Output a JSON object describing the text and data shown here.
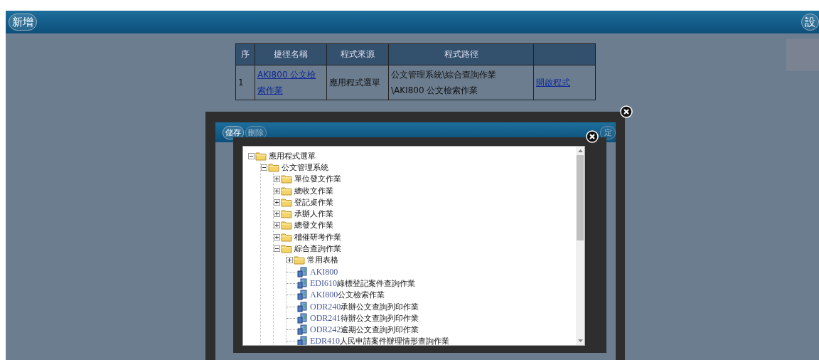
{
  "toolbar": {
    "buttons": [
      {
        "label": "新增"
      },
      {
        "label": "設"
      }
    ]
  },
  "table": {
    "columns": [
      "序",
      "捷徑名稱",
      "程式來源",
      "程式路徑",
      ""
    ],
    "rows": [
      {
        "index": "1",
        "name": "AKI800 公文檢索作業",
        "source": "應用程式選單",
        "path_lines": [
          "公文管理系統\\綜合查詢作業",
          "\\AKI800 公文檢索作業"
        ],
        "action": "開啟程式"
      }
    ]
  },
  "dialog": {
    "buttons": [
      {
        "label": "儲存",
        "disabled": false
      },
      {
        "label": "刪除",
        "disabled": true
      }
    ],
    "right_button": {
      "label": "定",
      "disabled": true
    }
  },
  "tree_dialog": {
    "tree": [
      {
        "kind": "folder",
        "label": "應用程式選單",
        "expanded": true,
        "children": [
          {
            "kind": "folder",
            "label": "公文管理系統",
            "expanded": true,
            "children": [
              {
                "kind": "folder",
                "label": "單位發文作業",
                "expanded": false
              },
              {
                "kind": "folder",
                "label": "總收文作業",
                "expanded": false
              },
              {
                "kind": "folder",
                "label": "登記桌作業",
                "expanded": false
              },
              {
                "kind": "folder",
                "label": "承辦人作業",
                "expanded": false
              },
              {
                "kind": "folder",
                "label": "總發文作業",
                "expanded": false
              },
              {
                "kind": "folder",
                "label": "稽催研考作業",
                "expanded": false
              },
              {
                "kind": "folder",
                "label": "綜合查詢作業",
                "expanded": true,
                "children": [
                  {
                    "kind": "folder",
                    "label": "常用表格",
                    "expanded": false
                  },
                  {
                    "kind": "program",
                    "code": "AKI800"
                  },
                  {
                    "kind": "program",
                    "code": "EDI610",
                    "label": "綠標登記案件查詢作業"
                  },
                  {
                    "kind": "program",
                    "code": "AKI800",
                    "label": "公文檢索作業"
                  },
                  {
                    "kind": "program",
                    "code": "ODR240",
                    "label": "承辦公文查詢列印作業"
                  },
                  {
                    "kind": "program",
                    "code": "ODR241",
                    "label": "待辦公文查詢列印作業"
                  },
                  {
                    "kind": "program",
                    "code": "ODR242",
                    "label": "逾期公文查詢列印作業"
                  },
                  {
                    "kind": "program",
                    "code": "EDR410",
                    "label": "人民申請案件辦理情形查詢作業"
                  }
                ]
              }
            ]
          }
        ]
      }
    ]
  }
}
